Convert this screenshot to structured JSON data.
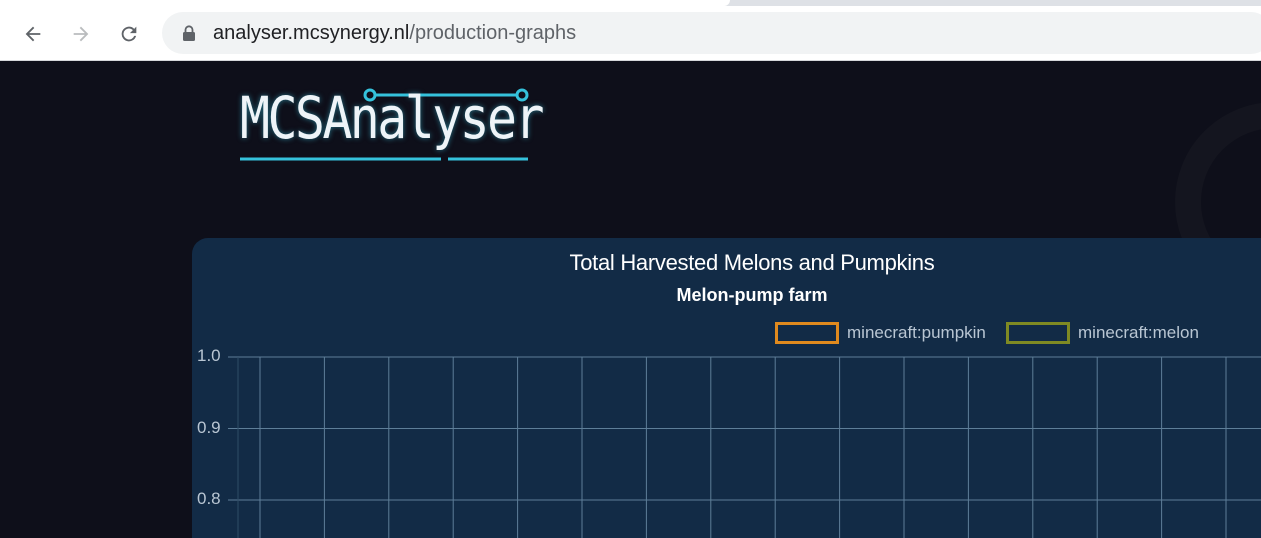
{
  "browser": {
    "url_host": "analyser.mcsynergy.nl",
    "url_path": "/production-graphs"
  },
  "logo": {
    "text": "MCSAnalyser"
  },
  "chart_data": {
    "type": "line",
    "title": "Total Harvested Melons and Pumpkins",
    "subtitle": "Melon-pump farm",
    "series": [
      {
        "name": "minecraft:pumpkin",
        "color": "#e08a1e",
        "values": []
      },
      {
        "name": "minecraft:melon",
        "color": "#7f8a23",
        "values": []
      }
    ],
    "yticks": [
      "1.0",
      "0.9",
      "0.8"
    ],
    "ylim_visible": [
      0.8,
      1.0
    ],
    "grid": true,
    "legend_position": "top"
  },
  "colors": {
    "page_bg": "#0e0f1a",
    "panel_bg": "#122b46",
    "grid": "#5e7e98",
    "logo_accent": "#35c2dc"
  }
}
